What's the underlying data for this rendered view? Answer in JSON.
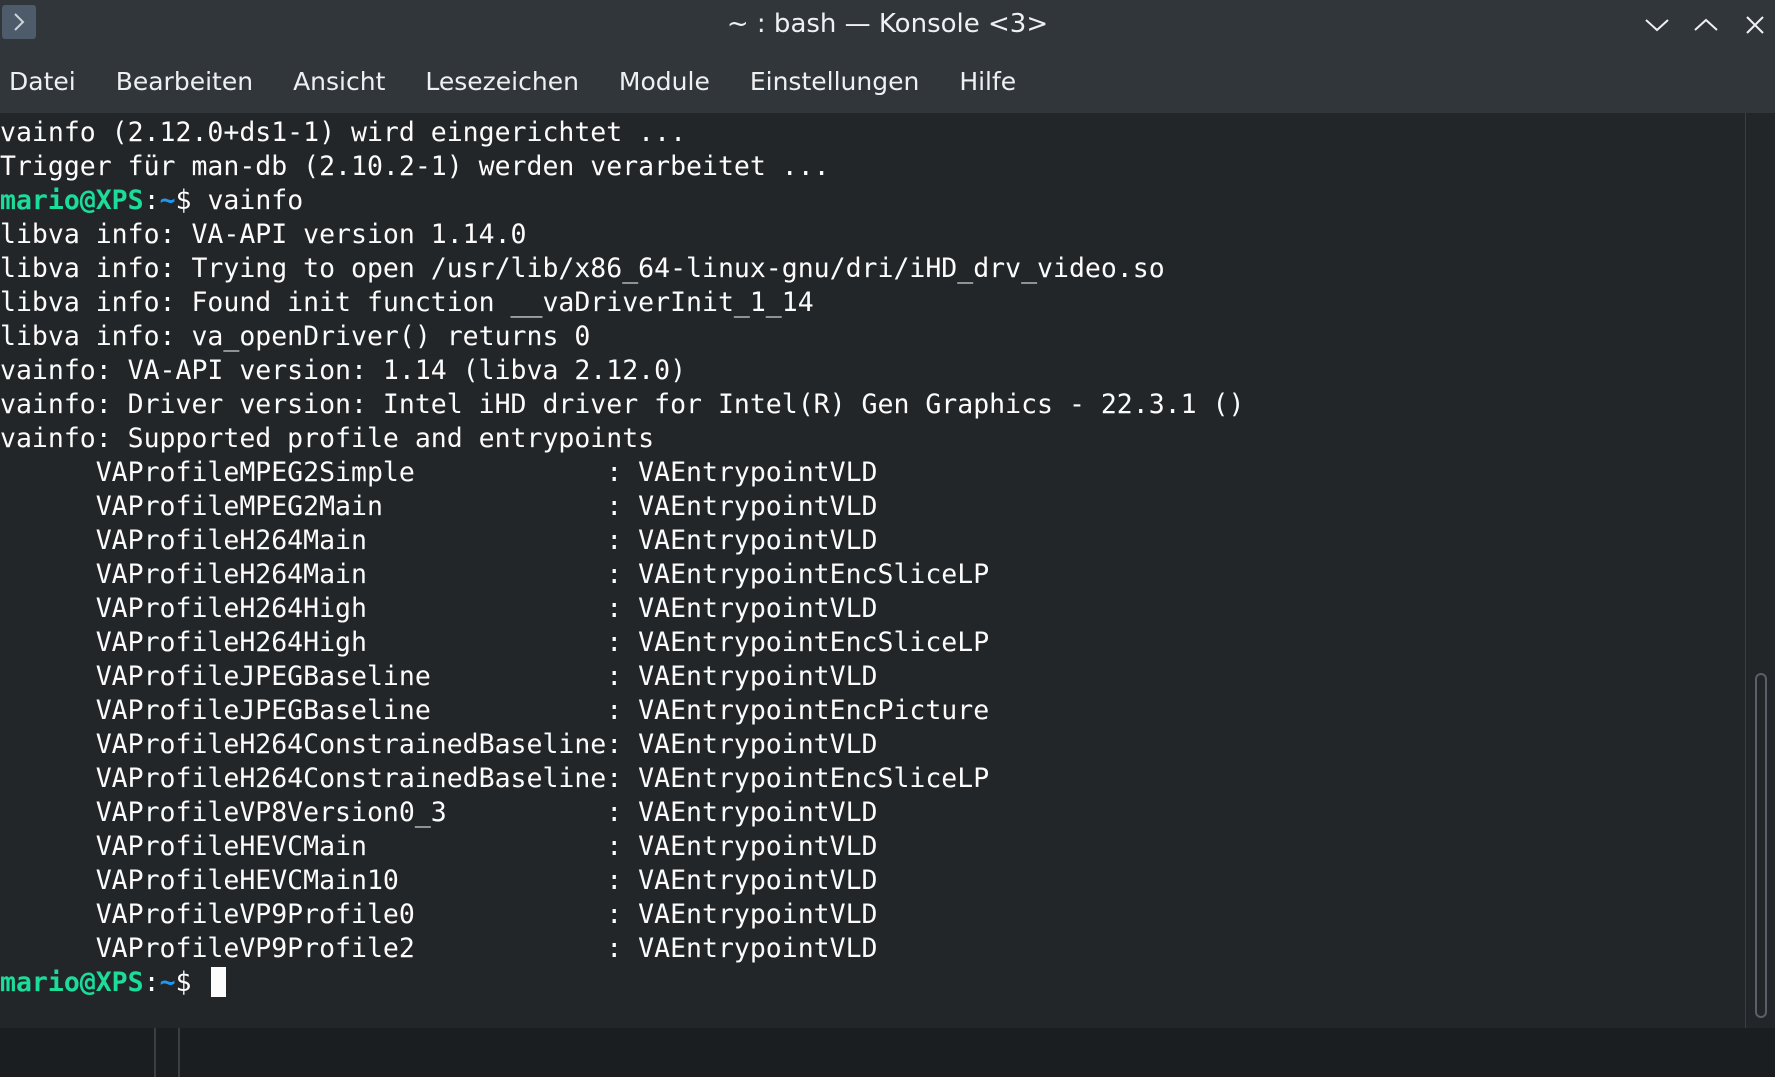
{
  "window": {
    "title": "~ : bash — Konsole <3>"
  },
  "menu": [
    {
      "label": "Datei"
    },
    {
      "label": "Bearbeiten"
    },
    {
      "label": "Ansicht"
    },
    {
      "label": "Lesezeichen"
    },
    {
      "label": "Module"
    },
    {
      "label": "Einstellungen"
    },
    {
      "label": "Hilfe"
    }
  ],
  "prompt": {
    "user_host": "mario@XPS",
    "sep": ":",
    "path": "~",
    "symbol": "$ "
  },
  "terminal": {
    "lines": [
      {
        "type": "text",
        "text": "vainfo (2.12.0+ds1-1) wird eingerichtet ..."
      },
      {
        "type": "text",
        "text": "Trigger für man-db (2.10.2-1) werden verarbeitet ..."
      },
      {
        "type": "prompt",
        "command": "vainfo"
      },
      {
        "type": "text",
        "text": "libva info: VA-API version 1.14.0"
      },
      {
        "type": "text",
        "text": "libva info: Trying to open /usr/lib/x86_64-linux-gnu/dri/iHD_drv_video.so"
      },
      {
        "type": "text",
        "text": "libva info: Found init function __vaDriverInit_1_14"
      },
      {
        "type": "text",
        "text": "libva info: va_openDriver() returns 0"
      },
      {
        "type": "text",
        "text": "vainfo: VA-API version: 1.14 (libva 2.12.0)"
      },
      {
        "type": "text",
        "text": "vainfo: Driver version: Intel iHD driver for Intel(R) Gen Graphics - 22.3.1 ()"
      },
      {
        "type": "text",
        "text": "vainfo: Supported profile and entrypoints"
      },
      {
        "type": "text",
        "text": "      VAProfileMPEG2Simple            : VAEntrypointVLD"
      },
      {
        "type": "text",
        "text": "      VAProfileMPEG2Main              : VAEntrypointVLD"
      },
      {
        "type": "text",
        "text": "      VAProfileH264Main               : VAEntrypointVLD"
      },
      {
        "type": "text",
        "text": "      VAProfileH264Main               : VAEntrypointEncSliceLP"
      },
      {
        "type": "text",
        "text": "      VAProfileH264High               : VAEntrypointVLD"
      },
      {
        "type": "text",
        "text": "      VAProfileH264High               : VAEntrypointEncSliceLP"
      },
      {
        "type": "text",
        "text": "      VAProfileJPEGBaseline           : VAEntrypointVLD"
      },
      {
        "type": "text",
        "text": "      VAProfileJPEGBaseline           : VAEntrypointEncPicture"
      },
      {
        "type": "text",
        "text": "      VAProfileH264ConstrainedBaseline: VAEntrypointVLD"
      },
      {
        "type": "text",
        "text": "      VAProfileH264ConstrainedBaseline: VAEntrypointEncSliceLP"
      },
      {
        "type": "text",
        "text": "      VAProfileVP8Version0_3          : VAEntrypointVLD"
      },
      {
        "type": "text",
        "text": "      VAProfileHEVCMain               : VAEntrypointVLD"
      },
      {
        "type": "text",
        "text": "      VAProfileHEVCMain10             : VAEntrypointVLD"
      },
      {
        "type": "text",
        "text": "      VAProfileVP9Profile0            : VAEntrypointVLD"
      },
      {
        "type": "text",
        "text": "      VAProfileVP9Profile2            : VAEntrypointVLD"
      },
      {
        "type": "prompt",
        "command": "",
        "cursor": true
      }
    ]
  },
  "colors": {
    "prompt_user": "#1cdc9a",
    "prompt_path": "#1d99f3",
    "text": "#fcfcfc",
    "background": "#232629"
  },
  "icons": {
    "app": "chevron-right-icon",
    "minimize": "chevron-down-icon",
    "maximize": "chevron-up-icon",
    "close": "close-icon"
  }
}
